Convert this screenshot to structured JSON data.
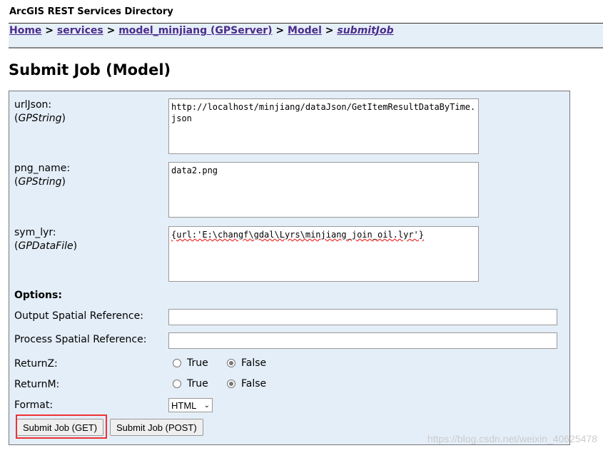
{
  "header": {
    "title": "ArcGIS REST Services Directory"
  },
  "breadcrumb": {
    "items": [
      "Home",
      "services",
      "model_minjiang (GPServer)",
      "Model",
      "submitJob"
    ],
    "separator": ">"
  },
  "page_title": "Submit Job (Model)",
  "params": [
    {
      "name": "urlJson:",
      "type": "GPString",
      "value": "http://localhost/minjiang/dataJson/GetItemResultDataByTime.json"
    },
    {
      "name": "png_name:",
      "type": "GPString",
      "value": "data2.png"
    },
    {
      "name": "sym_lyr:",
      "type": "GPDataFile",
      "value": "{url:'E:\\changf\\gdal\\Lyrs\\minjiang_join_oil.lyr'}"
    }
  ],
  "options": {
    "heading": "Options:",
    "out_sr_label": "Output Spatial Reference:",
    "out_sr_value": "",
    "proc_sr_label": "Process Spatial Reference:",
    "proc_sr_value": "",
    "returnz_label": "ReturnZ:",
    "returnm_label": "ReturnM:",
    "true_label": "True",
    "false_label": "False",
    "returnz_value": "False",
    "returnm_value": "False",
    "format_label": "Format:",
    "format_value": "HTML"
  },
  "buttons": {
    "get": "Submit Job (GET)",
    "post": "Submit Job (POST)"
  },
  "highlight_color": "#e33333",
  "watermark": "https://blog.csdn.net/weixin_40625478"
}
